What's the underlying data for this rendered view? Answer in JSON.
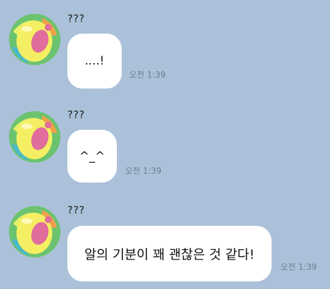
{
  "messages": [
    {
      "sender": "???",
      "text": "....!",
      "time": "오전 1:39"
    },
    {
      "sender": "???",
      "text": "^_^",
      "time": "오전 1:39"
    },
    {
      "sender": "???",
      "text": "알의 기분이 꽤 괜찮은 것 같다!",
      "time": "오전 1:39"
    }
  ],
  "colors": {
    "background": "#abc1d9",
    "bubble": "#ffffff",
    "time_text": "#6e7d8f"
  },
  "avatar_icon": "egg-avatar-icon"
}
